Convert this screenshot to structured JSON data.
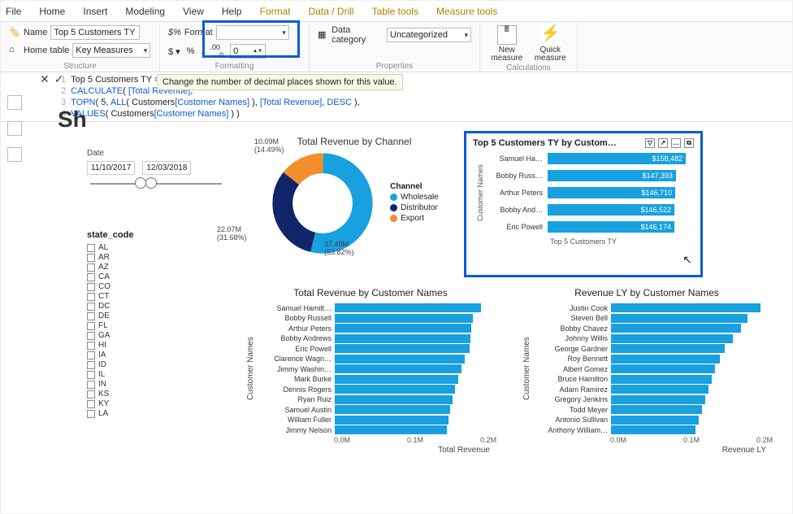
{
  "menu": {
    "items": [
      "File",
      "Home",
      "Insert",
      "Modeling",
      "View",
      "Help",
      "Format",
      "Data / Drill",
      "Table tools",
      "Measure tools"
    ],
    "context_start": 6
  },
  "ribbon": {
    "structure": {
      "name_label": "Name",
      "name_value": "Top 5 Customers TY",
      "home_label": "Home table",
      "home_value": "Key Measures",
      "group": "Structure"
    },
    "formatting": {
      "format_label": "Format",
      "format_value": "",
      "decimals_value": "0",
      "glyphs": [
        "$",
        "%",
        "%",
        "9",
        ",0",
        ".00"
      ],
      "group": "Formatting",
      "tooltip": "Change the number of decimal places shown for this value."
    },
    "properties": {
      "datacat_label": "Data category",
      "datacat_value": "Uncategorized",
      "group": "Properties"
    },
    "calculations": {
      "new": "New measure",
      "quick": "Quick measure",
      "group": "Calculations"
    }
  },
  "formula": {
    "lines": [
      "Top 5 Customers TY =",
      "CALCULATE( [Total Revenue],",
      "    TOPN( 5, ALL( Customers[Customer Names] ), [Total Revenue], DESC ),",
      "    VALUES( Customers[Customer Names] ) )"
    ]
  },
  "big": "Sh",
  "slicer": {
    "title": "Date",
    "from": "11/10/2017",
    "to": "12/03/2018"
  },
  "state": {
    "title": "state_code",
    "items": [
      "AL",
      "AR",
      "AZ",
      "CA",
      "CO",
      "CT",
      "DC",
      "DE",
      "FL",
      "GA",
      "HI",
      "IA",
      "ID",
      "IL",
      "IN",
      "KS",
      "KY",
      "LA"
    ]
  },
  "donut": {
    "title": "Total Revenue by Channel",
    "legend_header": "Channel",
    "legend": [
      {
        "name": "Wholesale",
        "color": "#18a0e0"
      },
      {
        "name": "Distributor",
        "color": "#12246a"
      },
      {
        "name": "Export",
        "color": "#f28e2b"
      }
    ],
    "labels": {
      "whole": "37.49M\n(53.82%)",
      "dist": "22.07M\n(31.68%)",
      "exp": "10.09M\n(14.49%)"
    }
  },
  "top5": {
    "title": "Top 5 Customers TY by Custom…",
    "ylabel": "Customer Names",
    "xcap": "Top 5 Customers TY",
    "rows": [
      {
        "name": "Samuel Ha…",
        "val": "$158,482",
        "w": 170
      },
      {
        "name": "Bobby Russ…",
        "val": "$147,393",
        "w": 158
      },
      {
        "name": "Arthur Peters",
        "val": "$146,710",
        "w": 157
      },
      {
        "name": "Bobby And…",
        "val": "$146,522",
        "w": 156
      },
      {
        "name": "Eric Powell",
        "val": "$146,174",
        "w": 156
      }
    ]
  },
  "chart_left": {
    "title": "Total Revenue by Customer Names",
    "ylabel": "Customer Names",
    "xticks": [
      "0.0M",
      "0.1M",
      "0.2M"
    ],
    "xtitle": "Total Revenue",
    "rows": [
      {
        "name": "Samuel Hamilt…",
        "w": 180
      },
      {
        "name": "Bobby Russell",
        "w": 170
      },
      {
        "name": "Arthur Peters",
        "w": 168
      },
      {
        "name": "Bobby Andrews",
        "w": 167
      },
      {
        "name": "Eric Powell",
        "w": 166
      },
      {
        "name": "Clarence Wagn…",
        "w": 160
      },
      {
        "name": "Jimmy Washin…",
        "w": 156
      },
      {
        "name": "Mark Burke",
        "w": 152
      },
      {
        "name": "Dennis Rogers",
        "w": 148
      },
      {
        "name": "Ryan Ruiz",
        "w": 145
      },
      {
        "name": "Samuel Austin",
        "w": 142
      },
      {
        "name": "William Fuller",
        "w": 140
      },
      {
        "name": "Jimmy Nelson",
        "w": 138
      }
    ]
  },
  "chart_right": {
    "title": "Revenue LY by Customer Names",
    "ylabel": "Customer Names",
    "xticks": [
      "0.0M",
      "0.1M",
      "0.2M"
    ],
    "xtitle": "Revenue LY",
    "rows": [
      {
        "name": "Justin Cook",
        "w": 184
      },
      {
        "name": "Steven Bell",
        "w": 168
      },
      {
        "name": "Bobby Chavez",
        "w": 160
      },
      {
        "name": "Johnny Willis",
        "w": 150
      },
      {
        "name": "George Gardner",
        "w": 140
      },
      {
        "name": "Roy Bennett",
        "w": 134
      },
      {
        "name": "Albert Gomez",
        "w": 128
      },
      {
        "name": "Bruce Hamilton",
        "w": 124
      },
      {
        "name": "Adam Ramirez",
        "w": 120
      },
      {
        "name": "Gregory Jenkins",
        "w": 116
      },
      {
        "name": "Todd Meyer",
        "w": 112
      },
      {
        "name": "Antonio Sullivan",
        "w": 108
      },
      {
        "name": "Anthony William…",
        "w": 104
      }
    ]
  },
  "chart_data": [
    {
      "type": "pie",
      "title": "Total Revenue by Channel",
      "series": [
        {
          "name": "Wholesale",
          "value": 37.49,
          "pct": 53.82
        },
        {
          "name": "Distributor",
          "value": 22.07,
          "pct": 31.68
        },
        {
          "name": "Export",
          "value": 10.09,
          "pct": 14.49
        }
      ]
    },
    {
      "type": "bar",
      "title": "Top 5 Customers TY by Customer Names",
      "xlabel": "Top 5 Customers TY",
      "ylabel": "Customer Names",
      "categories": [
        "Samuel Hamilton",
        "Bobby Russell",
        "Arthur Peters",
        "Bobby Andrews",
        "Eric Powell"
      ],
      "values": [
        158482,
        147393,
        146710,
        146522,
        146174
      ]
    },
    {
      "type": "bar",
      "title": "Total Revenue by Customer Names",
      "xlabel": "Total Revenue",
      "ylabel": "Customer Names",
      "xlim": [
        0,
        200000
      ],
      "categories": [
        "Samuel Hamilton",
        "Bobby Russell",
        "Arthur Peters",
        "Bobby Andrews",
        "Eric Powell",
        "Clarence Wagner",
        "Jimmy Washington",
        "Mark Burke",
        "Dennis Rogers",
        "Ryan Ruiz",
        "Samuel Austin",
        "William Fuller",
        "Jimmy Nelson"
      ],
      "values": [
        180000,
        170000,
        168000,
        167000,
        166000,
        160000,
        156000,
        152000,
        148000,
        145000,
        142000,
        140000,
        138000
      ]
    },
    {
      "type": "bar",
      "title": "Revenue LY by Customer Names",
      "xlabel": "Revenue LY",
      "ylabel": "Customer Names",
      "xlim": [
        0,
        200000
      ],
      "categories": [
        "Justin Cook",
        "Steven Bell",
        "Bobby Chavez",
        "Johnny Willis",
        "George Gardner",
        "Roy Bennett",
        "Albert Gomez",
        "Bruce Hamilton",
        "Adam Ramirez",
        "Gregory Jenkins",
        "Todd Meyer",
        "Antonio Sullivan",
        "Anthony Williams"
      ],
      "values": [
        184000,
        168000,
        160000,
        150000,
        140000,
        134000,
        128000,
        124000,
        120000,
        116000,
        112000,
        108000,
        104000
      ]
    }
  ]
}
